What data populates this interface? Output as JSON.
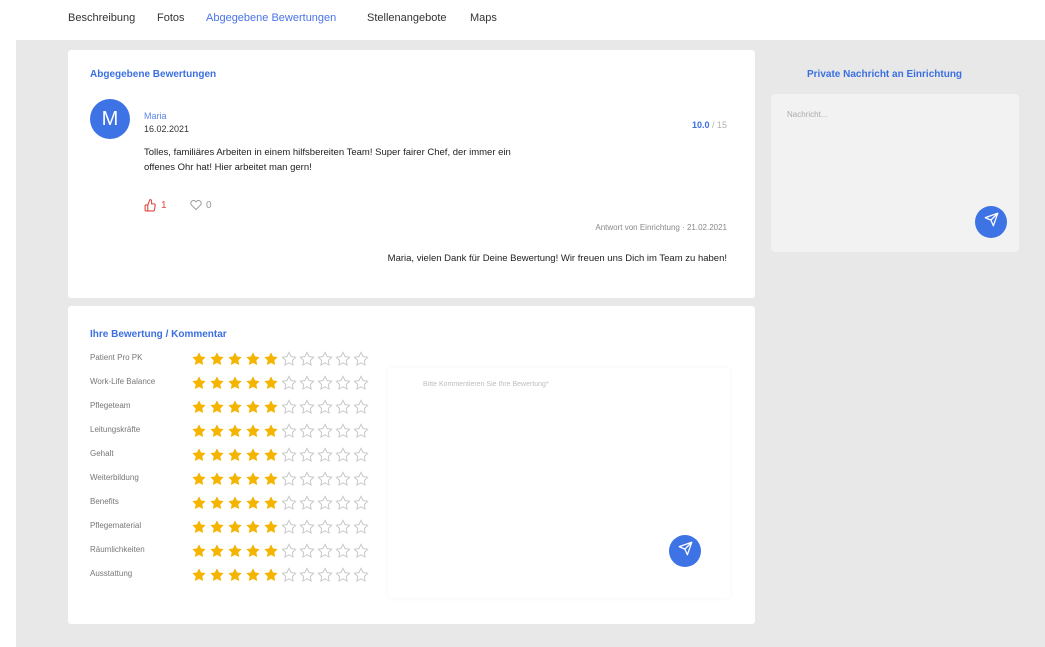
{
  "nav": {
    "tabs": [
      {
        "label": "Beschreibung",
        "active": false
      },
      {
        "label": "Fotos",
        "active": false
      },
      {
        "label": "Abgegebene Bewertungen",
        "active": true
      },
      {
        "label": "Stellenangebote",
        "active": false
      },
      {
        "label": "Maps",
        "active": false
      }
    ]
  },
  "review_card": {
    "title": "Abgegebene Bewertungen",
    "avatar_letter": "M",
    "reviewer_name": "Maria",
    "date": "16.02.2021",
    "score": "10.0",
    "score_max": "/ 15",
    "text": "Tolles, familiäres Arbeiten in einem hilfsbereiten Team! Super fairer Chef, der immer ein offenes Ohr hat! Hier arbeitet man gern!",
    "likes": "1",
    "dislikes": "0",
    "answer_meta": "Antwort von Einrichtung · 21.02.2021",
    "answer_text": "Maria, vielen Dank für Deine Bewertung! Wir freuen uns Dich im Team zu haben!"
  },
  "rating_card": {
    "title": "Ihre Bewertung / Kommentar",
    "max_stars": 10,
    "categories": [
      {
        "label": "Patient Pro PK",
        "stars": 5
      },
      {
        "label": "Work-Life Balance",
        "stars": 5
      },
      {
        "label": "Pflegeteam",
        "stars": 5
      },
      {
        "label": "Leitungskräfte",
        "stars": 5
      },
      {
        "label": "Gehalt",
        "stars": 5
      },
      {
        "label": "Weiterbildung",
        "stars": 5
      },
      {
        "label": "Benefits",
        "stars": 5
      },
      {
        "label": "Pflegematerial",
        "stars": 5
      },
      {
        "label": "Räumlichkeiten",
        "stars": 5
      },
      {
        "label": "Ausstattung",
        "stars": 5
      }
    ],
    "comment_placeholder": "Bitte Kommentieren Sie Ihre Bewertung*"
  },
  "sidebar": {
    "title": "Private Nachricht an Einrichtung",
    "message_placeholder": "Nachricht..."
  },
  "colors": {
    "accent": "#3e73e6",
    "star_filled": "#f5b400",
    "star_empty": "#c8c8c8",
    "like": "#e0463f"
  },
  "icons": [
    "thumbs-up-icon",
    "heart-icon",
    "send-icon",
    "star-icon"
  ]
}
